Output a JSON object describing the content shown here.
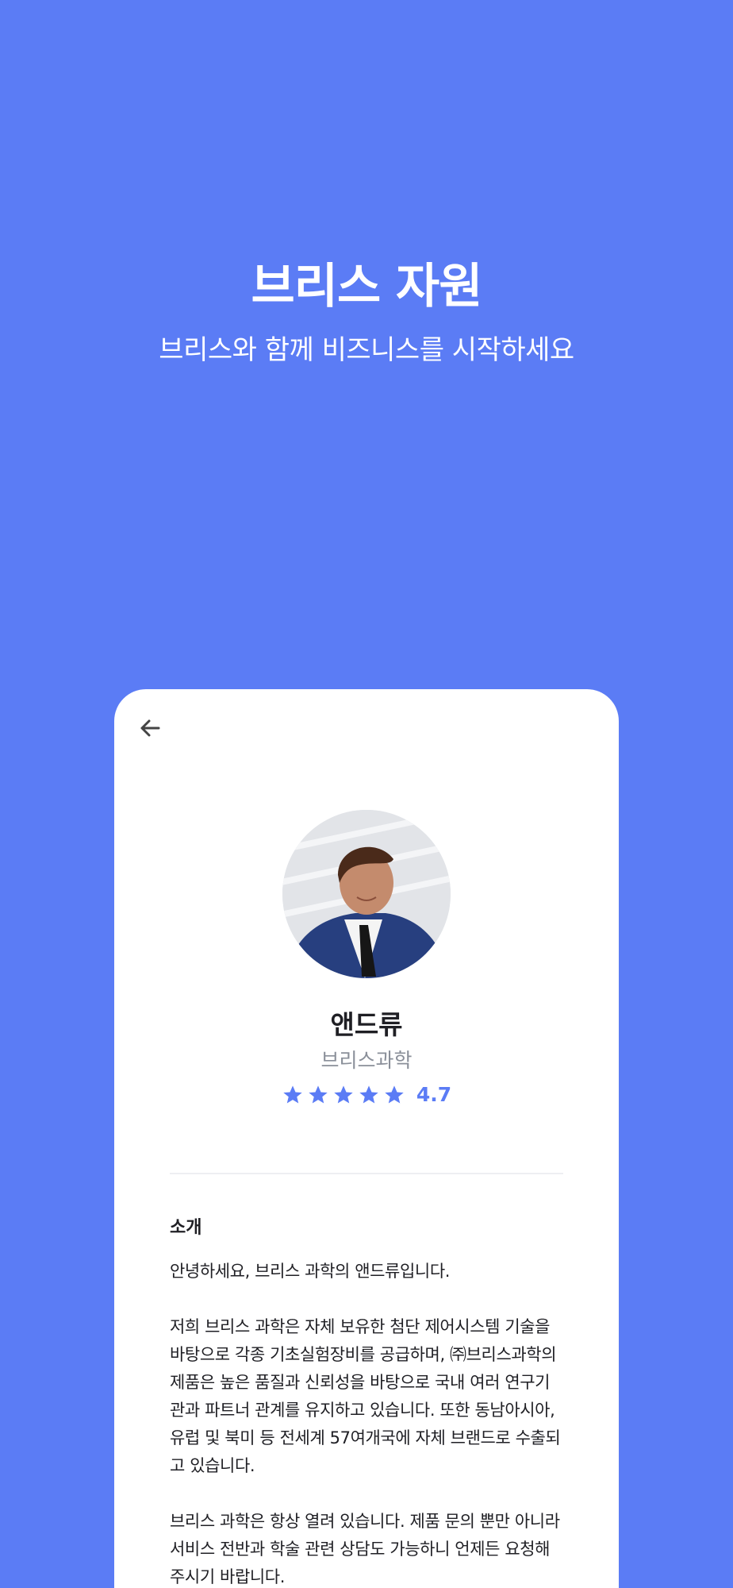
{
  "hero": {
    "title": "브리스 자원",
    "subtitle": "브리스와 함께 비즈니스를 시작하세요"
  },
  "profile": {
    "name": "앤드류",
    "company": "브리스과학",
    "rating": {
      "stars": 5,
      "value": "4.7"
    }
  },
  "intro": {
    "title": "소개",
    "paragraphs": [
      "안녕하세요, 브리스 과학의 앤드류입니다.",
      "저희 브리스 과학은 자체 보유한 첨단 제어시스템 기술을 바탕으로 각종 기초실험장비를 공급하며, ㈜브리스과학의 제품은 높은 품질과 신뢰성을 바탕으로 국내 여러 연구기관과 파트너 관계를 유지하고 있습니다. 또한 동남아시아, 유럽 및 북미 등 전세계 57여개국에 자체 브랜드로 수출되고 있습니다.",
      "브리스 과학은 항상 열려 있습니다. 제품 문의 뿐만 아니라 서비스 전반과 학술 관련 상담도 가능하니 언제든 요청해 주시기 바랍니다."
    ]
  },
  "icons": {
    "back": "arrow-left-icon",
    "star": "star-icon"
  },
  "colors": {
    "accent": "#5b7cf5",
    "background": "#5b7cf5",
    "card": "#ffffff",
    "muted": "#8a8f99"
  }
}
